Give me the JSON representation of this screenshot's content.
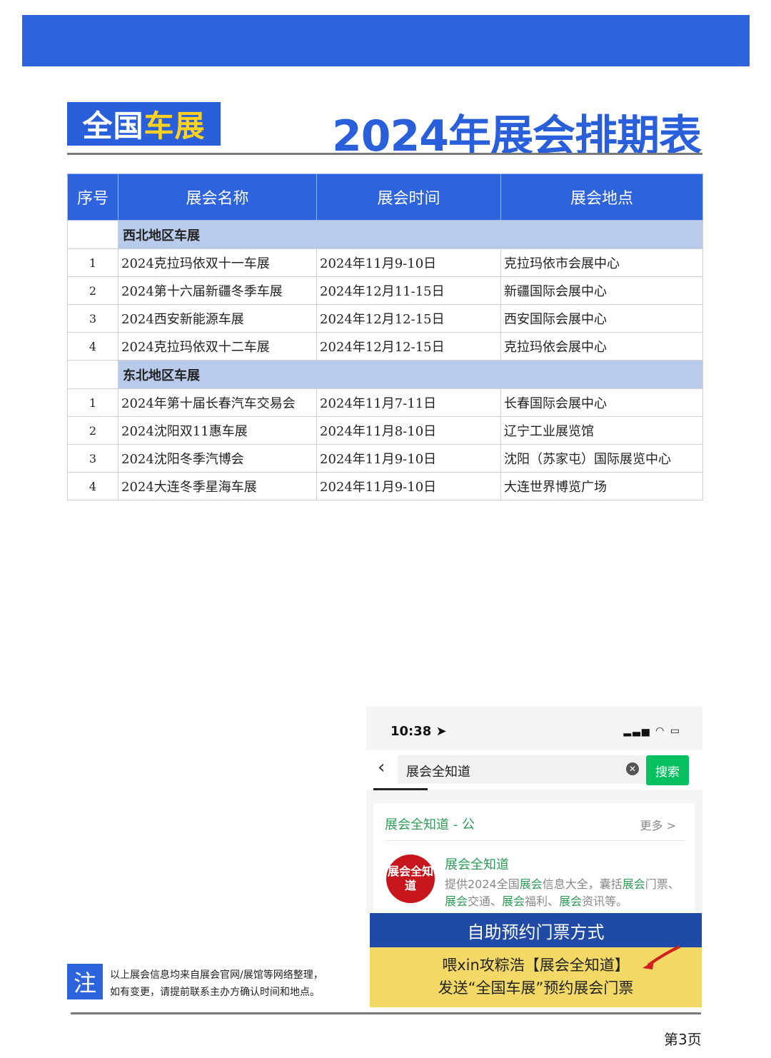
{
  "header": {
    "brand_part1": "全国",
    "brand_part2": "车展",
    "title": "2024年展会排期表"
  },
  "table": {
    "columns": [
      "序号",
      "展会名称",
      "展会时间",
      "展会地点"
    ],
    "regions": [
      {
        "name": "西北地区车展",
        "rows": [
          {
            "no": "1",
            "name": "2024克拉玛依双十一车展",
            "date": "2024年11月9-10日",
            "place": "克拉玛依市会展中心"
          },
          {
            "no": "2",
            "name": "2024第十六届新疆冬季车展",
            "date": "2024年12月11-15日",
            "place": "新疆国际会展中心"
          },
          {
            "no": "3",
            "name": "2024西安新能源车展",
            "date": "2024年12月12-15日",
            "place": "西安国际会展中心"
          },
          {
            "no": "4",
            "name": "2024克拉玛依双十二车展",
            "date": "2024年12月12-15日",
            "place": "克拉玛依会展中心"
          }
        ]
      },
      {
        "name": "东北地区车展",
        "rows": [
          {
            "no": "1",
            "name": "2024年第十届长春汽车交易会",
            "date": "2024年11月7-11日",
            "place": "长春国际会展中心"
          },
          {
            "no": "2",
            "name": "2024沈阳双11惠车展",
            "date": "2024年11月8-10日",
            "place": "辽宁工业展览馆"
          },
          {
            "no": "3",
            "name": "2024沈阳冬季汽博会",
            "date": "2024年11月9-10日",
            "place": "沈阳（苏家屯）国际展览中心"
          },
          {
            "no": "4",
            "name": "2024大连冬季星海车展",
            "date": "2024年11月9-10日",
            "place": "大连世界博览广场"
          }
        ]
      }
    ]
  },
  "phone": {
    "time": "10:38",
    "search_text": "展会全知道",
    "search_button": "搜索",
    "card_header": "展会全知道 - 公",
    "card_more": "更多 >",
    "logo_text": "展会全知道",
    "account_name": "展会全知道",
    "desc_parts": [
      "提供2024全国",
      "展会",
      "信息大全，囊括",
      "展会",
      "门票、",
      "展会",
      "交通、",
      "展会",
      "福利、",
      "展会",
      "资讯等。"
    ]
  },
  "ticket": {
    "title": "自助预约门票方式",
    "line1": "喂xin攻粽浩【展会全知道】",
    "line2": "发送“全国车展”预约展会门票"
  },
  "note": {
    "label": "注",
    "line1": "以上展会信息均来自展会官网/展馆等网络整理，",
    "line2": "如有变更，请提前联系主办方确认时间和地点。"
  },
  "footer": {
    "page": "第3页"
  },
  "colors": {
    "primary_blue": "#2d63dd",
    "region_band": "#b8cbea",
    "accent_yellow": "#ffd21f",
    "wechat_green": "#07c160"
  }
}
